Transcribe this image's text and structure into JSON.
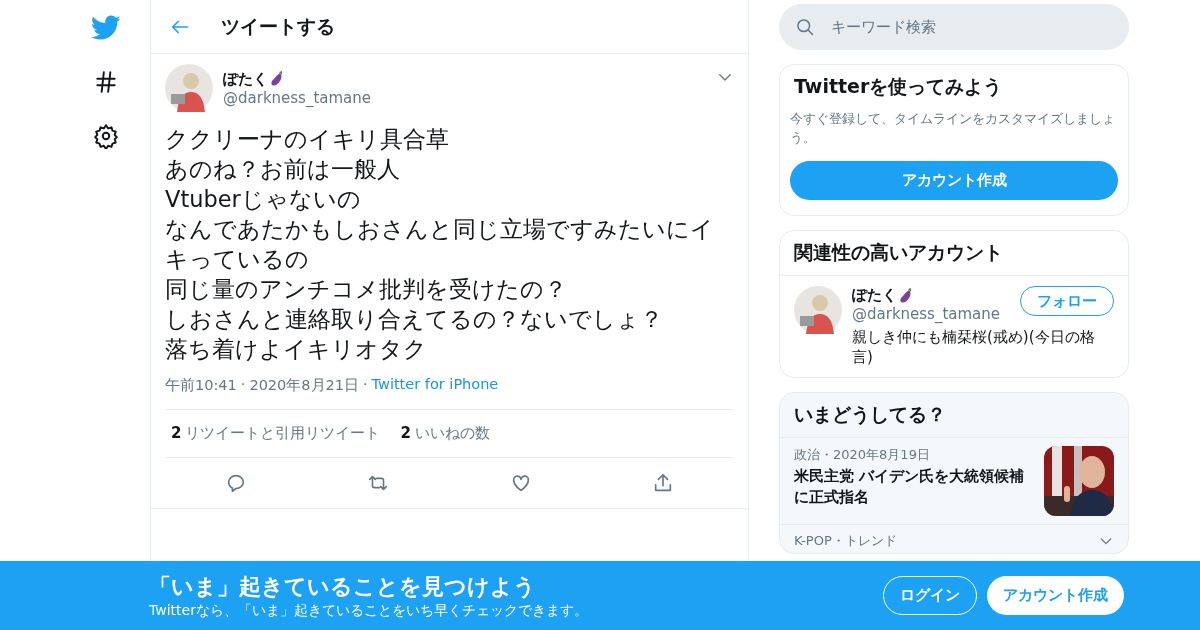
{
  "header": {
    "title": "ツイートする"
  },
  "search": {
    "placeholder": "キーワード検索"
  },
  "tweet": {
    "name": "ぽたく",
    "handle": "@darkness_tamane",
    "lines": [
      "ククリーナのイキリ具合草",
      "あのね？お前は一般人",
      "Vtuberじゃないの",
      "なんであたかもしおさんと同じ立場ですみたいにイキっているの",
      "同じ量のアンチコメ批判を受けたの？",
      "しおさんと連絡取り合えてるの？ないでしょ？",
      "落ち着けよイキリオタク"
    ],
    "time": "午前10:41",
    "separator": "·",
    "date": "2020年8月21日",
    "source": "Twitter for iPhone",
    "stats": [
      {
        "count": "2",
        "label": "リツイートと引用リツイート"
      },
      {
        "count": "2",
        "label": "いいねの数"
      }
    ]
  },
  "signup_card": {
    "title": "Twitterを使ってみよう",
    "text": "今すぐ登録して、タイムラインをカスタマイズしましょう。",
    "button": "アカウント作成"
  },
  "related_card": {
    "title": "関連性の高いアカウント",
    "name": "ぽたく",
    "handle": "@darkness_tamane",
    "bio": "親しき仲にも楠栞桜(戒め)(今日の格言)",
    "button": "フォロー"
  },
  "trends_card": {
    "title": "いまどうしてる？",
    "items": [
      {
        "kind": "news",
        "meta": "政治・2020年8月19日",
        "headline": "米民主党 バイデン氏を大統領候補に正式指名"
      },
      {
        "kind": "trend",
        "meta": "K-POP・トレンド"
      }
    ]
  },
  "banner": {
    "title": "「いま」起きていることを見つけよう",
    "subtitle": "Twitterなら、「いま」起きていることをいち早くチェックできます。",
    "login": "ログイン",
    "signup": "アカウント作成"
  }
}
